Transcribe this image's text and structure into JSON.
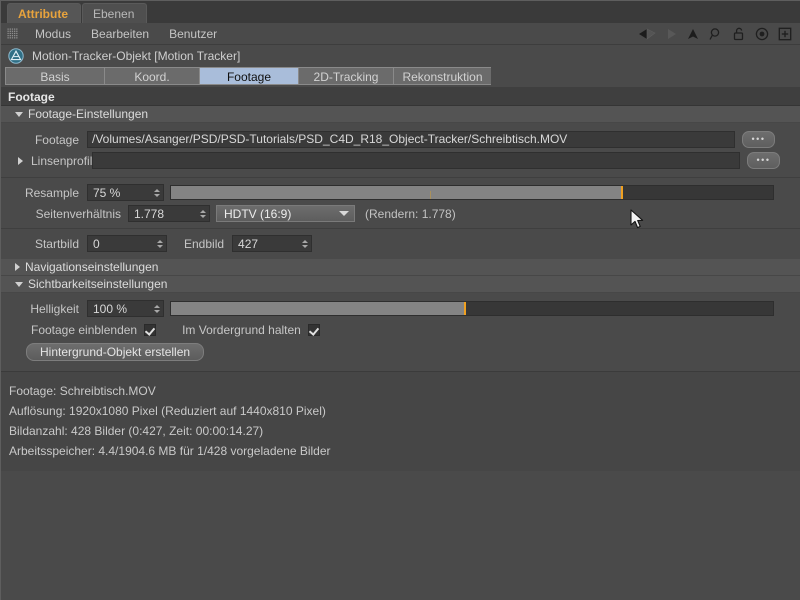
{
  "window": {
    "tabs": [
      {
        "label": "Attribute",
        "active": true
      },
      {
        "label": "Ebenen",
        "active": false
      }
    ]
  },
  "menu": {
    "items": [
      "Modus",
      "Bearbeiten",
      "Benutzer"
    ],
    "icons": [
      "back-arrow-icon",
      "forward-arrow-icon",
      "up-arrow-icon",
      "search-icon",
      "lock-icon",
      "target-icon",
      "plus-icon"
    ]
  },
  "object": {
    "icon": "motion-tracker-icon",
    "title": "Motion-Tracker-Objekt [Motion Tracker]"
  },
  "attribute_tabs": [
    {
      "label": "Basis",
      "active": false
    },
    {
      "label": "Koord.",
      "active": false
    },
    {
      "label": "Footage",
      "active": true
    },
    {
      "label": "2D-Tracking",
      "active": false
    },
    {
      "label": "Rekonstruktion",
      "active": false
    }
  ],
  "section": {
    "title": "Footage"
  },
  "groups": {
    "footage_settings": {
      "label": "Footage-Einstellungen",
      "expanded": true
    },
    "navigation_settings": {
      "label": "Navigationseinstellungen",
      "expanded": false
    },
    "visibility_settings": {
      "label": "Sichtbarkeitseinstellungen",
      "expanded": true
    }
  },
  "fields": {
    "footage": {
      "label": "Footage",
      "value": "/Volumes/Asanger/PSD/PSD-Tutorials/PSD_C4D_R18_Object-Tracker/Schreibtisch.MOV",
      "browse_label": "•••"
    },
    "lens_profile": {
      "label": "Linsenprofil",
      "value": "",
      "browse_label": "•••",
      "expanded": false
    },
    "resample": {
      "label": "Resample",
      "value": "75 %",
      "slider_percent": 75,
      "slider_marker_color": "#f0a020"
    },
    "aspect_ratio": {
      "label": "Seitenverhältnis",
      "value": "1.778",
      "preset": "HDTV (16:9)",
      "note": "(Rendern: 1.778)"
    },
    "start_frame": {
      "label": "Startbild",
      "value": "0"
    },
    "end_frame": {
      "label": "Endbild",
      "value": "427"
    },
    "brightness": {
      "label": "Helligkeit",
      "value": "100 %",
      "slider_percent": 49,
      "slider_marker_color": "#f0a020"
    },
    "show_footage": {
      "label": "Footage einblenden",
      "checked": true
    },
    "keep_foreground": {
      "label": "Im Vordergrund halten",
      "checked": true
    },
    "create_background": {
      "label": "Hintergrund-Objekt erstellen"
    }
  },
  "info": {
    "lines": [
      "Footage: Schreibtisch.MOV",
      "Auflösung: 1920x1080 Pixel (Reduziert auf 1440x810 Pixel)",
      "Bildanzahl: 428 Bilder (0:427, Zeit: 00:00:14.27)",
      "Arbeitsspeicher: 4.4/1904.6 MB für 1/428 vorgeladene Bilder"
    ]
  },
  "colors": {
    "accent_tab_text": "#e8a33d",
    "active_tab_bg": "#a9bdda",
    "slider_marker": "#f0a020",
    "panel_bg": "#4a4a4a"
  }
}
